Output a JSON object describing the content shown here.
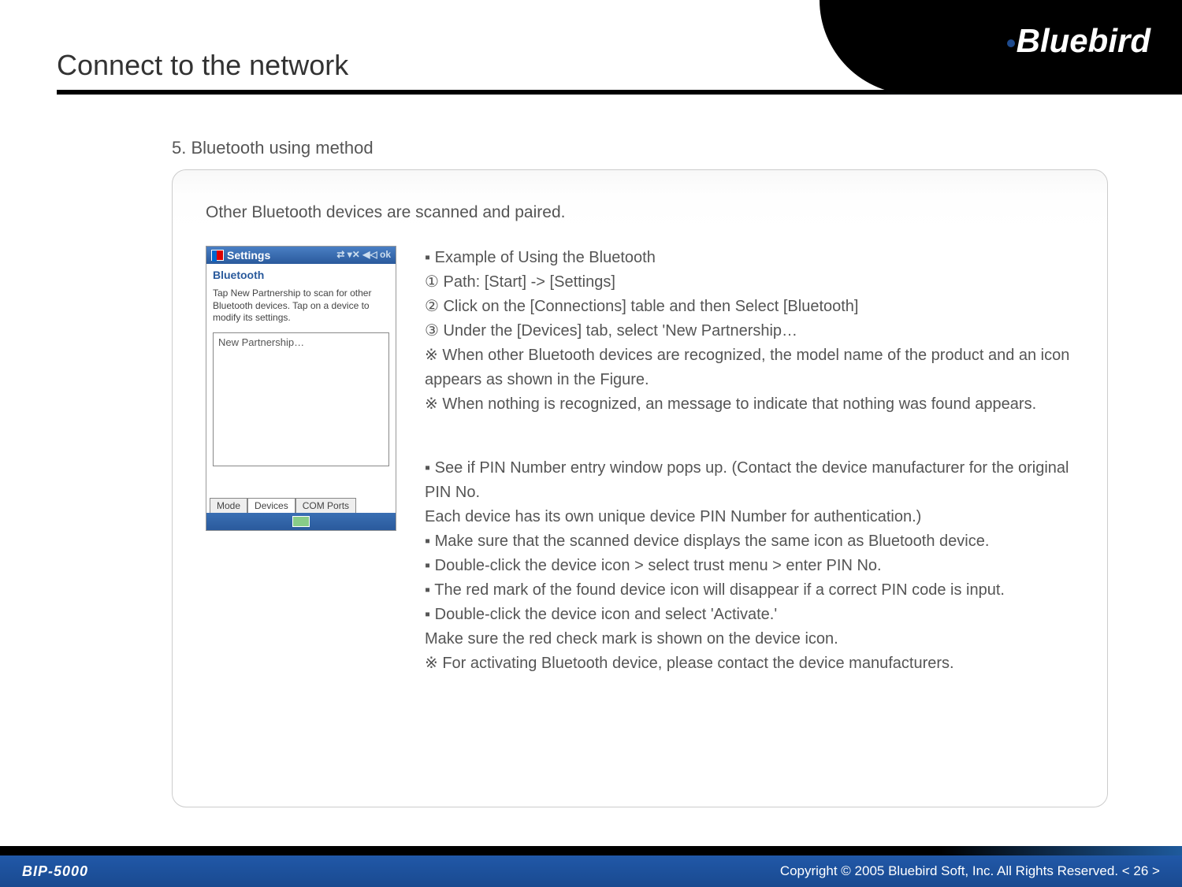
{
  "brand": "Bluebird",
  "page_title": "Connect to the network",
  "section_title": "5. Bluetooth using method",
  "intro": "Other Bluetooth devices are scanned and paired.",
  "screenshot": {
    "title": "Settings",
    "status": "⇄ ▾✕ ◀◁ ok",
    "subtitle": "Bluetooth",
    "description": "Tap New Partnership to scan for other Bluetooth devices. Tap on a device to modify its settings.",
    "list_item": "New Partnership…",
    "tabs": {
      "t1": "Mode",
      "t2": "Devices",
      "t3": "COM Ports"
    }
  },
  "instr": {
    "heading": "▪ Example of Using the Bluetooth",
    "step1": "① Path: [Start] -> [Settings]",
    "step2": "② Click on the [Connections] table and then Select [Bluetooth]",
    "step3": "③ Under the [Devices] tab, select 'New Partnership…",
    "note1": "※ When other Bluetooth devices are recognized, the model name of the product and an icon appears as shown in the Figure.",
    "note2": "※ When nothing is recognized, an message to indicate that nothing was found appears.",
    "pin1": "▪ See if PIN Number entry window pops up. (Contact the device manufacturer for the original PIN No.",
    "pin2": "Each device has its own unique device PIN Number for authentication.)",
    "pin3": "▪ Make sure that the scanned device displays the same icon as Bluetooth device.",
    "pin4": "▪ Double-click the device icon > select trust menu > enter PIN No.",
    "pin5": "▪ The red mark of the found device icon will disappear if a correct PIN code is input.",
    "pin6": "▪ Double-click the device icon and select 'Activate.'",
    "final1": "Make sure the red check mark is shown on the device icon.",
    "final2": "※ For activating Bluetooth device, please contact the device manufacturers."
  },
  "footer": {
    "product": "BIP-5000",
    "copyright": "Copyright © 2005 Bluebird Soft, Inc. All Rights Reserved.   < 26 >"
  }
}
